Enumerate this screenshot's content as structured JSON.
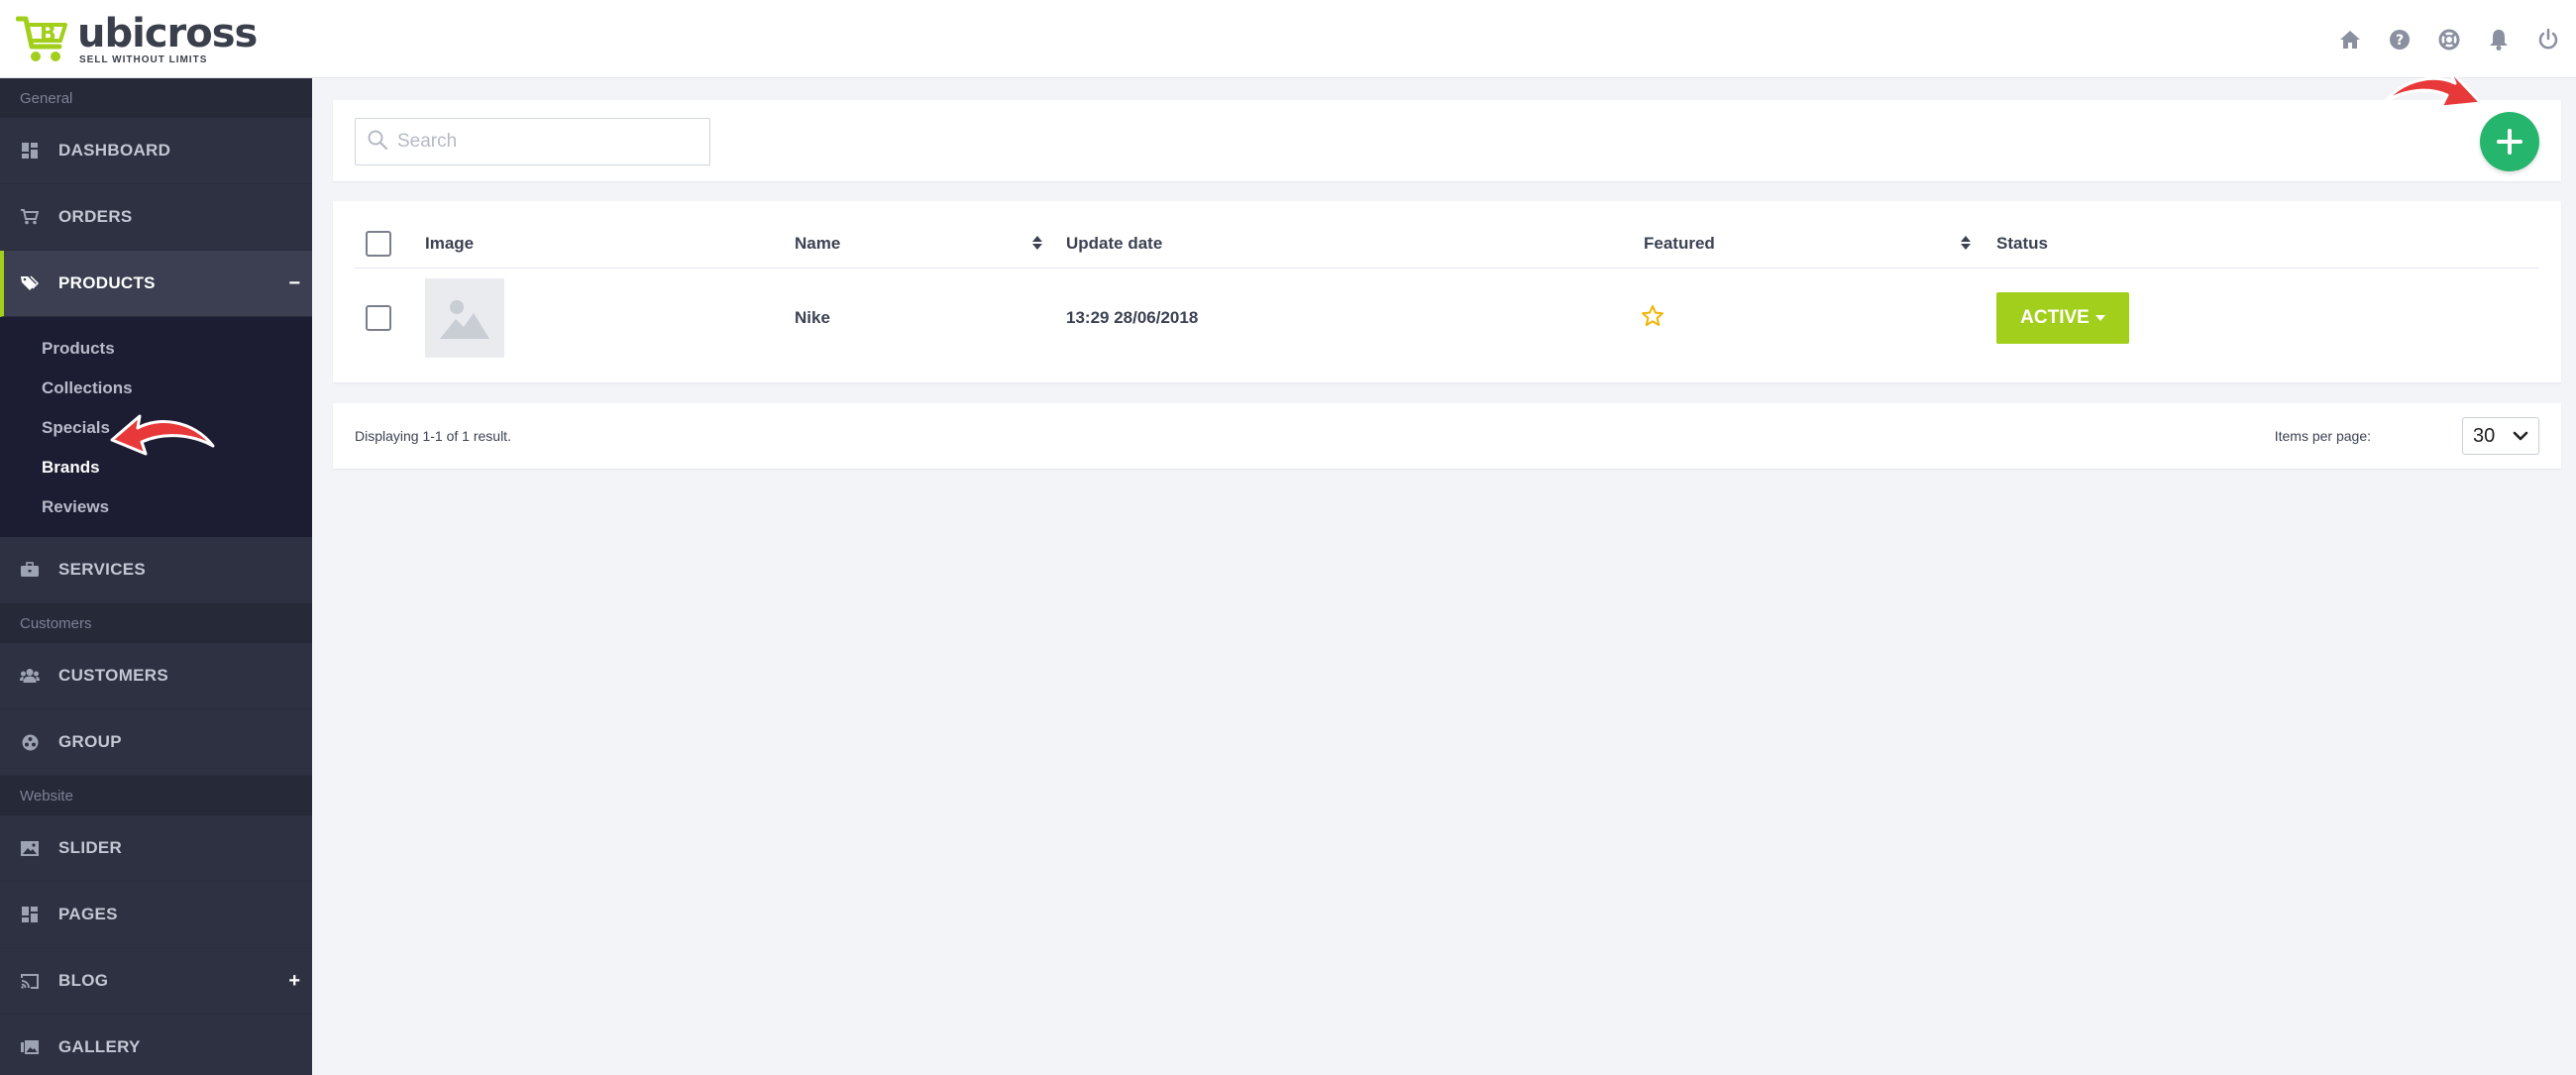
{
  "brand": {
    "name": "ubicross",
    "tagline": "SELL WITHOUT LIMITS"
  },
  "top_icons": [
    "home-icon",
    "help-icon",
    "lifebuoy-icon",
    "bell-icon",
    "power-icon"
  ],
  "sidebar": {
    "sections": [
      {
        "title": "General"
      },
      {
        "title": "Customers"
      },
      {
        "title": "Website"
      }
    ],
    "items": {
      "dashboard": "DASHBOARD",
      "orders": "ORDERS",
      "products": "PRODUCTS",
      "products_toggle": "−",
      "services": "SERVICES",
      "customers": "CUSTOMERS",
      "group": "GROUP",
      "slider": "SLIDER",
      "pages": "PAGES",
      "blog": "BLOG",
      "blog_toggle": "+",
      "gallery": "GALLERY"
    },
    "products_sub": [
      "Products",
      "Collections",
      "Specials",
      "Brands",
      "Reviews"
    ],
    "current_sub": "Brands"
  },
  "search": {
    "placeholder": "Search",
    "value": ""
  },
  "table": {
    "headers": {
      "image": "Image",
      "name": "Name",
      "update_date": "Update date",
      "featured": "Featured",
      "status": "Status"
    },
    "rows": [
      {
        "name": "Nike",
        "update_date": "13:29 28/06/2018",
        "featured": false,
        "status": "ACTIVE"
      }
    ]
  },
  "footer": {
    "display_text": "Displaying 1-1 of 1 result.",
    "items_per_page_label": "Items per page:",
    "items_per_page_value": "30"
  },
  "colors": {
    "accent": "#a2cf1b",
    "add_button": "#26b56d",
    "sidebar_bg": "#2e3141",
    "submenu_bg": "#1c1d33",
    "annotation_arrow": "#e8393a",
    "star": "#f0b400"
  }
}
